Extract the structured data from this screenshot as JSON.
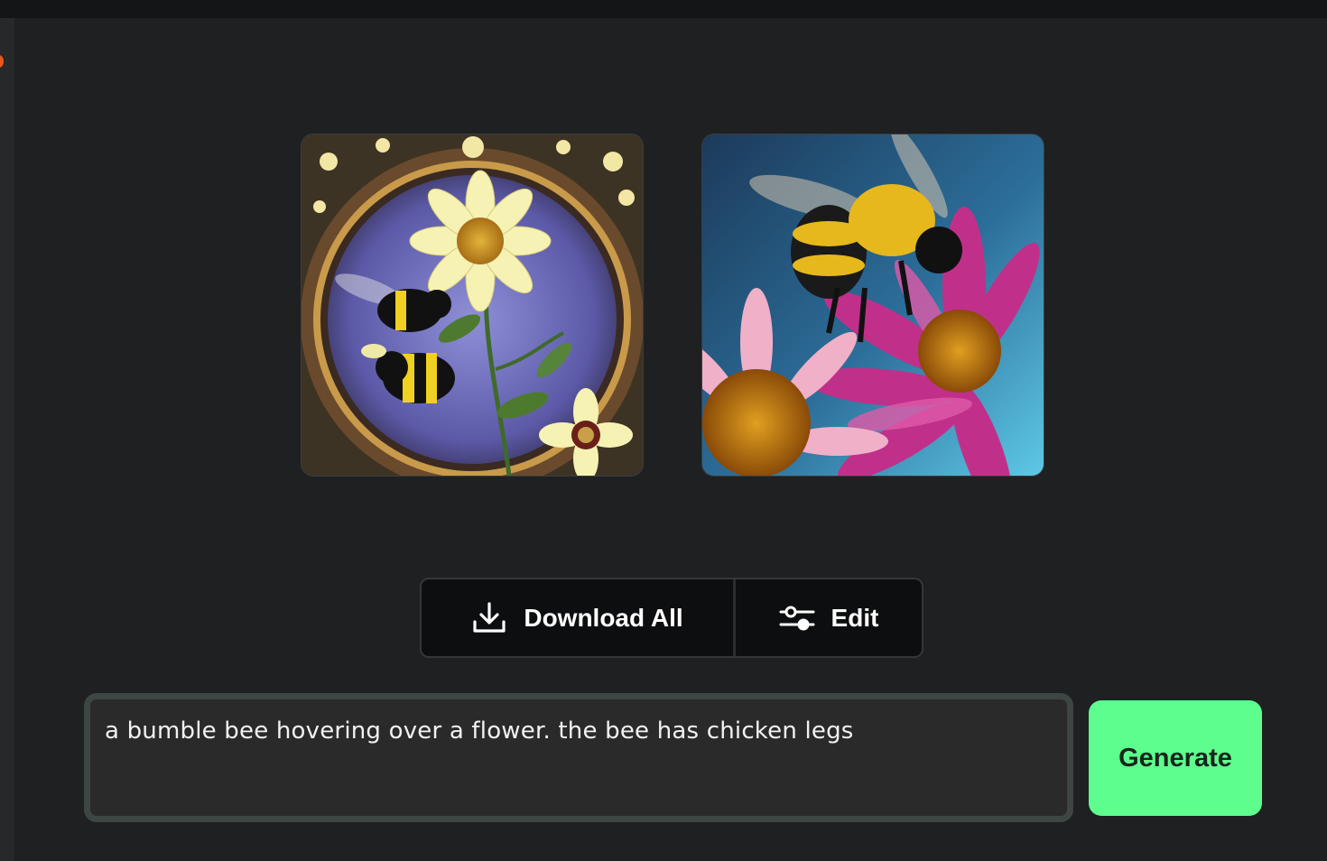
{
  "actions": {
    "download_all_label": "Download All",
    "edit_label": "Edit"
  },
  "prompt": {
    "value": "a bumble bee hovering over a flower. the bee has chicken legs"
  },
  "generate": {
    "label": "Generate"
  },
  "colors": {
    "background": "#1e2021",
    "generate_button": "#5dfd8e",
    "action_bar": "#0d0e0f"
  },
  "icons": {
    "download": "download-icon",
    "edit": "sliders-icon"
  }
}
